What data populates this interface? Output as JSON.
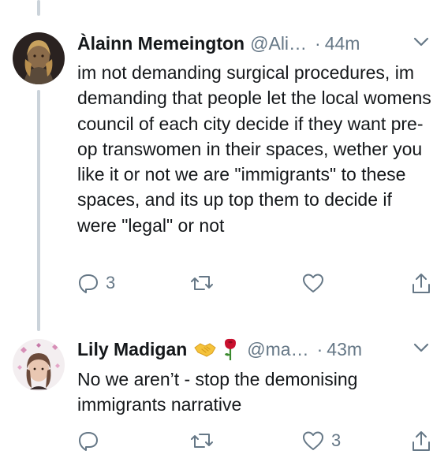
{
  "tweets": [
    {
      "display_name": "Àlainn Memeington",
      "handle": "@Ali…",
      "separator": "·",
      "time": "44m",
      "text": "im not demanding surgical procedures, im demanding that people let the local womens council of each city decide if they want pre-op transwomen in their spaces, wether you like it or not we are \"immigrants\" to these spaces, and its up top them to decide if were \"legal\" or not",
      "reply_count": "3",
      "retweet_count": "",
      "like_count": ""
    },
    {
      "display_name": "Lily Madigan",
      "name_emojis": [
        "handshake-emoji",
        "rose-emoji"
      ],
      "handle": "@ma…",
      "separator": "·",
      "time": "43m",
      "text": "No we aren’t - stop the demonising immigrants narrative",
      "reply_count": "",
      "retweet_count": "",
      "like_count": "3"
    }
  ],
  "colors": {
    "text": "#14171a",
    "secondary": "#657786",
    "thread_line": "#cbd3da",
    "background": "#ffffff"
  },
  "icons": [
    "chevron-down-icon",
    "reply-icon",
    "retweet-icon",
    "like-icon",
    "share-icon"
  ]
}
